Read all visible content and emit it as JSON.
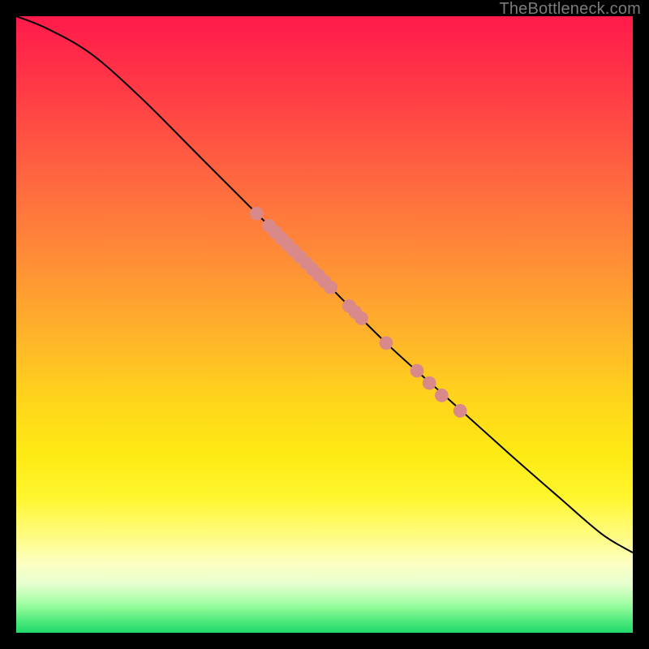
{
  "watermark": "TheBottleneck.com",
  "chart_data": {
    "type": "line",
    "title": "",
    "xlabel": "",
    "ylabel": "",
    "xlim": [
      0,
      100
    ],
    "ylim": [
      0,
      100
    ],
    "grid": false,
    "legend": false,
    "background_gradient": {
      "direction": "vertical",
      "stops": [
        {
          "pos": 0,
          "color": "#ff1a4a"
        },
        {
          "pos": 50,
          "color": "#ffc71e"
        },
        {
          "pos": 80,
          "color": "#fffb60"
        },
        {
          "pos": 100,
          "color": "#1fd96a"
        }
      ]
    },
    "series": [
      {
        "name": "curve",
        "color": "#000000",
        "x": [
          0,
          5,
          12,
          20,
          30,
          40,
          50,
          60,
          70,
          80,
          88,
          95,
          100
        ],
        "y": [
          100,
          98,
          94,
          87,
          77,
          67,
          57,
          47,
          38,
          29,
          22,
          16,
          13
        ]
      }
    ],
    "markers": {
      "name": "highlight-points",
      "color": "#d98989",
      "radius": 1.1,
      "points": [
        {
          "x": 39,
          "y": 68
        },
        {
          "x": 41,
          "y": 66
        },
        {
          "x": 42,
          "y": 65
        },
        {
          "x": 43,
          "y": 64
        },
        {
          "x": 44,
          "y": 63
        },
        {
          "x": 45,
          "y": 62
        },
        {
          "x": 46,
          "y": 61
        },
        {
          "x": 47,
          "y": 60
        },
        {
          "x": 48,
          "y": 59
        },
        {
          "x": 49,
          "y": 58
        },
        {
          "x": 50,
          "y": 57
        },
        {
          "x": 51,
          "y": 56
        },
        {
          "x": 54,
          "y": 53
        },
        {
          "x": 55,
          "y": 52
        },
        {
          "x": 56,
          "y": 51
        },
        {
          "x": 60,
          "y": 47
        },
        {
          "x": 65,
          "y": 42.5
        },
        {
          "x": 67,
          "y": 40.5
        },
        {
          "x": 69,
          "y": 38.5
        },
        {
          "x": 72,
          "y": 36
        }
      ]
    }
  }
}
